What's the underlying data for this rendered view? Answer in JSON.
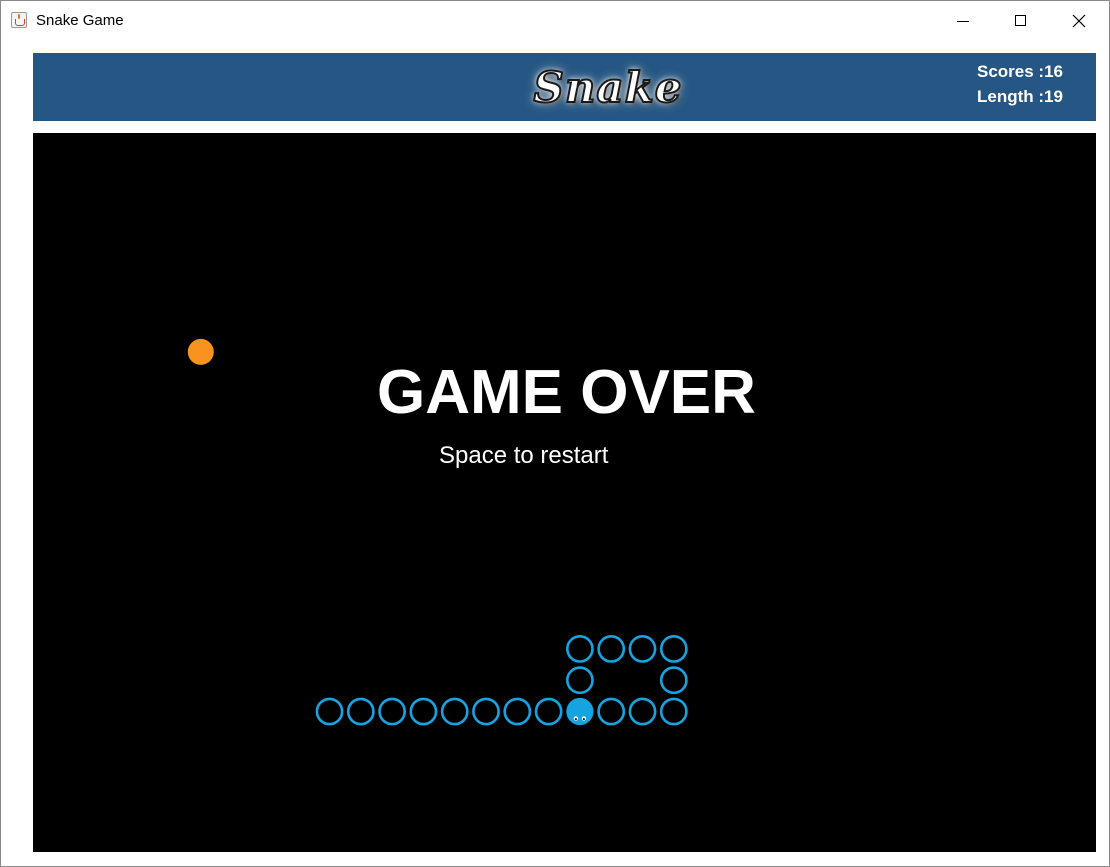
{
  "window": {
    "title": "Snake Game",
    "app_icon": "java-cup-icon",
    "controls": [
      "minimize-icon",
      "maximize-icon",
      "close-icon"
    ]
  },
  "header": {
    "logo_text": "Snake",
    "scores_label": "Scores :16",
    "length_label": "Length :19",
    "background_color": "#265784"
  },
  "board": {
    "background_color": "#000000",
    "message": "GAME OVER",
    "hint": "Space to restart",
    "food_color": "#f7931e",
    "snake_color": "#16a3e2",
    "food": {
      "col": 5,
      "row": 6
    },
    "snake_head": {
      "col": 17,
      "row": 18
    },
    "snake_body": [
      {
        "col": 9,
        "row": 18
      },
      {
        "col": 10,
        "row": 18
      },
      {
        "col": 11,
        "row": 18
      },
      {
        "col": 12,
        "row": 18
      },
      {
        "col": 13,
        "row": 18
      },
      {
        "col": 14,
        "row": 18
      },
      {
        "col": 15,
        "row": 18
      },
      {
        "col": 16,
        "row": 18
      },
      {
        "col": 18,
        "row": 18
      },
      {
        "col": 19,
        "row": 18
      },
      {
        "col": 20,
        "row": 18
      },
      {
        "col": 20,
        "row": 17
      },
      {
        "col": 20,
        "row": 16
      },
      {
        "col": 19,
        "row": 16
      },
      {
        "col": 18,
        "row": 16
      },
      {
        "col": 17,
        "row": 16
      },
      {
        "col": 17,
        "row": 17
      }
    ]
  }
}
